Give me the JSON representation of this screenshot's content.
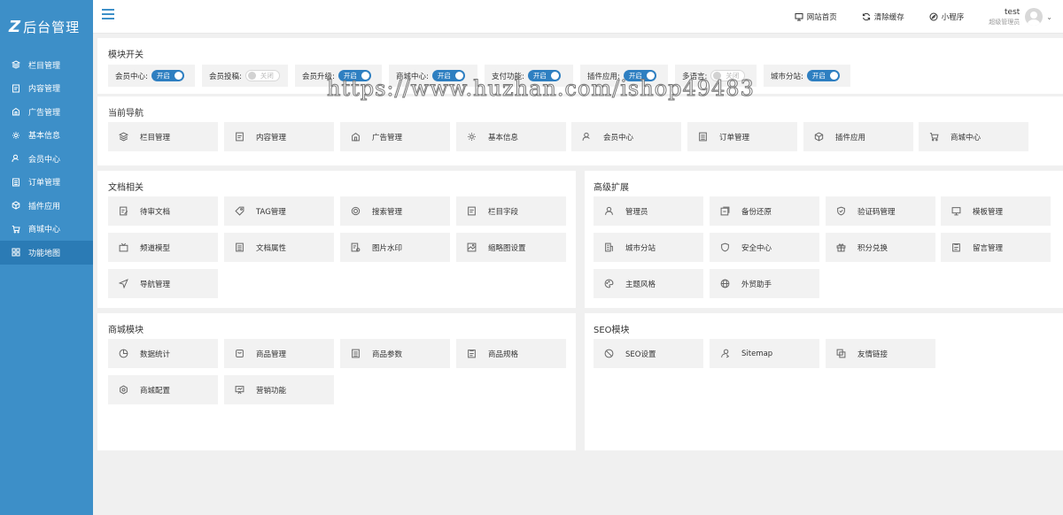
{
  "logo": {
    "mark": "Z",
    "text": "后台管理"
  },
  "sidebar": {
    "items": [
      {
        "label": "栏目管理",
        "icon": "layers-icon"
      },
      {
        "label": "内容管理",
        "icon": "document-icon"
      },
      {
        "label": "广告管理",
        "icon": "ad-icon"
      },
      {
        "label": "基本信息",
        "icon": "gear-icon"
      },
      {
        "label": "会员中心",
        "icon": "user-icon"
      },
      {
        "label": "订单管理",
        "icon": "list-icon"
      },
      {
        "label": "插件应用",
        "icon": "cube-icon"
      },
      {
        "label": "商城中心",
        "icon": "cart-icon"
      },
      {
        "label": "功能地图",
        "icon": "grid-icon",
        "active": true
      }
    ]
  },
  "header": {
    "actions": [
      {
        "label": "网站首页",
        "icon": "monitor-icon"
      },
      {
        "label": "清除缓存",
        "icon": "refresh-icon"
      },
      {
        "label": "小程序",
        "icon": "compass-icon"
      }
    ],
    "user": {
      "name": "test",
      "role": "超级管理员"
    }
  },
  "modules": {
    "title": "模块开关",
    "switches": [
      {
        "label": "会员中心:",
        "state": "开启",
        "on": true
      },
      {
        "label": "会员投稿:",
        "state": "关闭",
        "on": false
      },
      {
        "label": "会员升级:",
        "state": "开启",
        "on": true
      },
      {
        "label": "商城中心:",
        "state": "开启",
        "on": true
      },
      {
        "label": "支付功能:",
        "state": "开启",
        "on": true
      },
      {
        "label": "插件应用:",
        "state": "开启",
        "on": true
      },
      {
        "label": "多语言:",
        "state": "关闭",
        "on": false
      },
      {
        "label": "城市分站:",
        "state": "开启",
        "on": true
      }
    ]
  },
  "watermark": "https://www.huzhan.com/ishop49483",
  "current_nav": {
    "title": "当前导航",
    "items": [
      "栏目管理",
      "内容管理",
      "广告管理",
      "基本信息",
      "会员中心",
      "订单管理",
      "插件应用",
      "商城中心"
    ]
  },
  "doc": {
    "title": "文档相关",
    "items": [
      "待审文档",
      "TAG管理",
      "搜索管理",
      "栏目字段",
      "频道模型",
      "文档属性",
      "图片水印",
      "缩略图设置",
      "导航管理"
    ]
  },
  "advanced": {
    "title": "高级扩展",
    "items": [
      "管理员",
      "备份还原",
      "验证码管理",
      "模板管理",
      "城市分站",
      "安全中心",
      "积分兑换",
      "留言管理",
      "主题风格",
      "外贸助手"
    ]
  },
  "shop": {
    "title": "商城模块",
    "items": [
      "数据统计",
      "商品管理",
      "商品参数",
      "商品规格",
      "商城配置",
      "营销功能"
    ]
  },
  "seo": {
    "title": "SEO模块",
    "items": [
      "SEO设置",
      "Sitemap",
      "友情链接"
    ]
  },
  "colors": {
    "sidebar": "#3d8fc8",
    "sidebar_active": "#2b7bb5",
    "accent": "#2e7fc1",
    "tile": "#f2f2f2"
  }
}
